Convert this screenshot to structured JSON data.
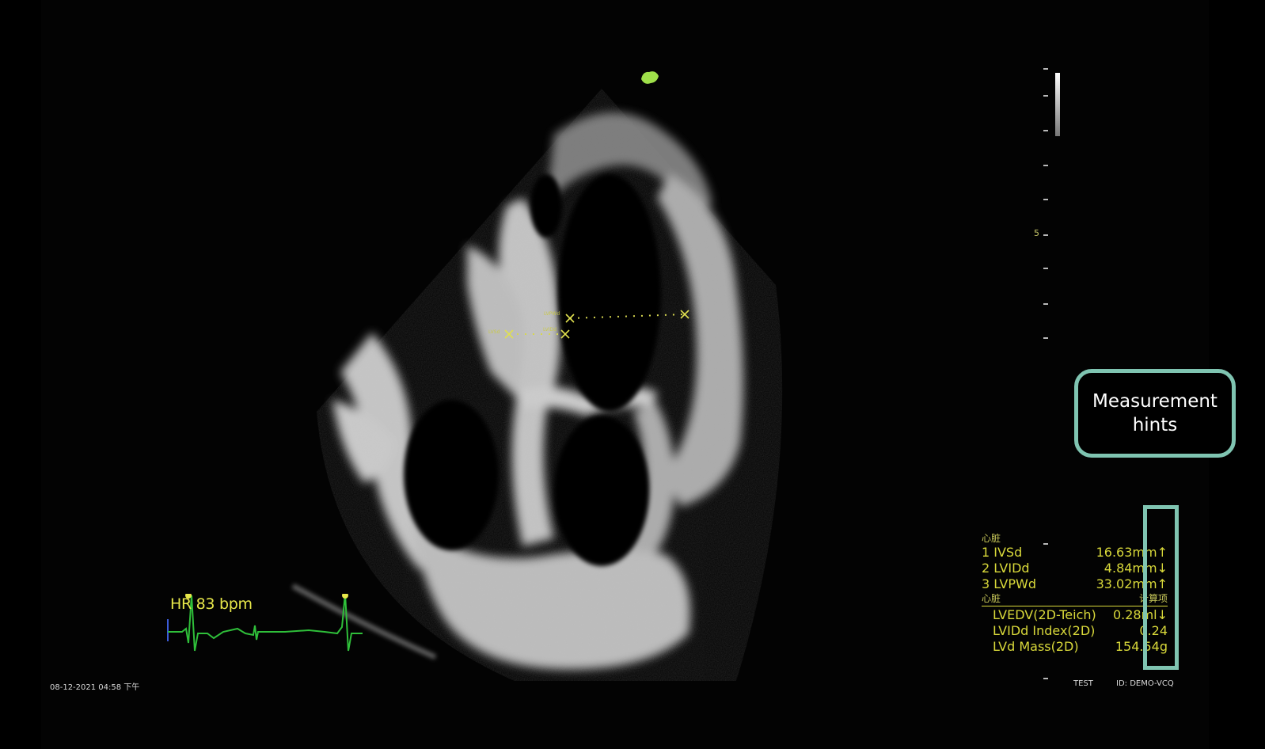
{
  "heart_rate": {
    "label": "HR 83 bpm"
  },
  "datetime": "08-12-2021 04:58 下午",
  "depth_scale": {
    "label": "5"
  },
  "measurements": {
    "section_header": "心脏",
    "items": [
      {
        "name": "1 IVSd",
        "value": "16.63mm↑"
      },
      {
        "name": "2 LVIDd",
        "value": "4.84mm↓"
      },
      {
        "name": "3 LVPWd",
        "value": "33.02mm↑"
      }
    ],
    "calc_header": "心脏",
    "calc_header_right": "计算项",
    "calc_items": [
      {
        "name": "LVEDV(2D-Teich)",
        "value": "0.28ml↓"
      },
      {
        "name": "LVIDd Index(2D)",
        "value": "0.24"
      },
      {
        "name": "LVd Mass(2D)",
        "value": "154.54g"
      }
    ]
  },
  "footer": {
    "patient": "TEST",
    "id": "ID: DEMO-VCQ"
  },
  "image_labels": {
    "lvsd": "LVSd",
    "lvpwd": "LVPWd",
    "lvidd": "LVIDd"
  },
  "callout": {
    "line1": "Measurement",
    "line2": "hints"
  },
  "colors": {
    "accent": "#7fc4b1",
    "measurement_text": "#d9d93a",
    "ecg": "#2fbf3a",
    "background": "#000000"
  }
}
